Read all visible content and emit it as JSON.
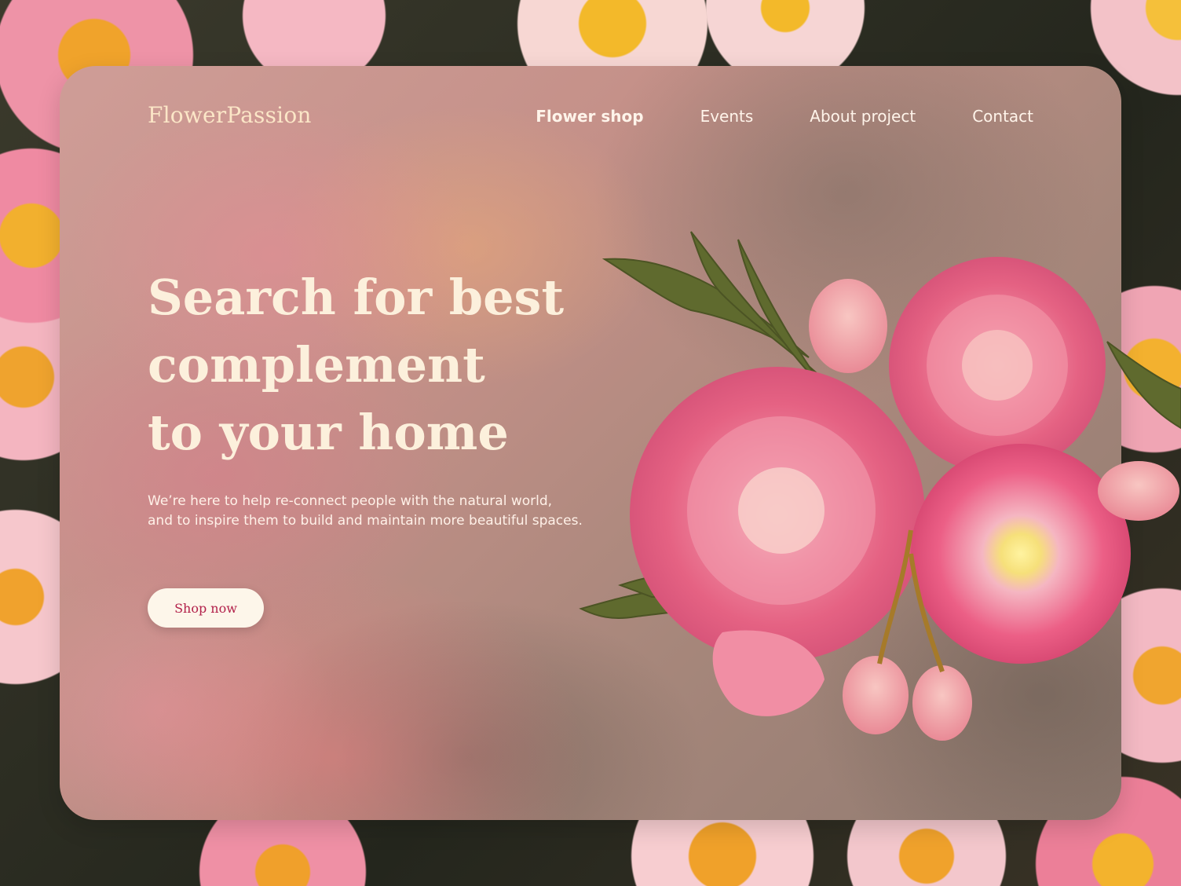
{
  "brand": {
    "logo": "FlowerPassion"
  },
  "nav": {
    "items": [
      {
        "label": "Flower shop",
        "active": true
      },
      {
        "label": "Events",
        "active": false
      },
      {
        "label": "About project",
        "active": false
      },
      {
        "label": "Contact",
        "active": false
      }
    ]
  },
  "hero": {
    "title_lines": [
      "Search for best",
      "complement",
      "to your home"
    ],
    "subtitle_lines": [
      "We’re here to help re-connect people with the natural world,",
      "and to inspire them to build and maintain more beautiful spaces."
    ],
    "cta_label": "Shop now"
  },
  "colors": {
    "accent": "#b2204a",
    "title": "#fcf0dc",
    "logo": "#fbe6c7",
    "button_bg": "#fdf6ea"
  }
}
